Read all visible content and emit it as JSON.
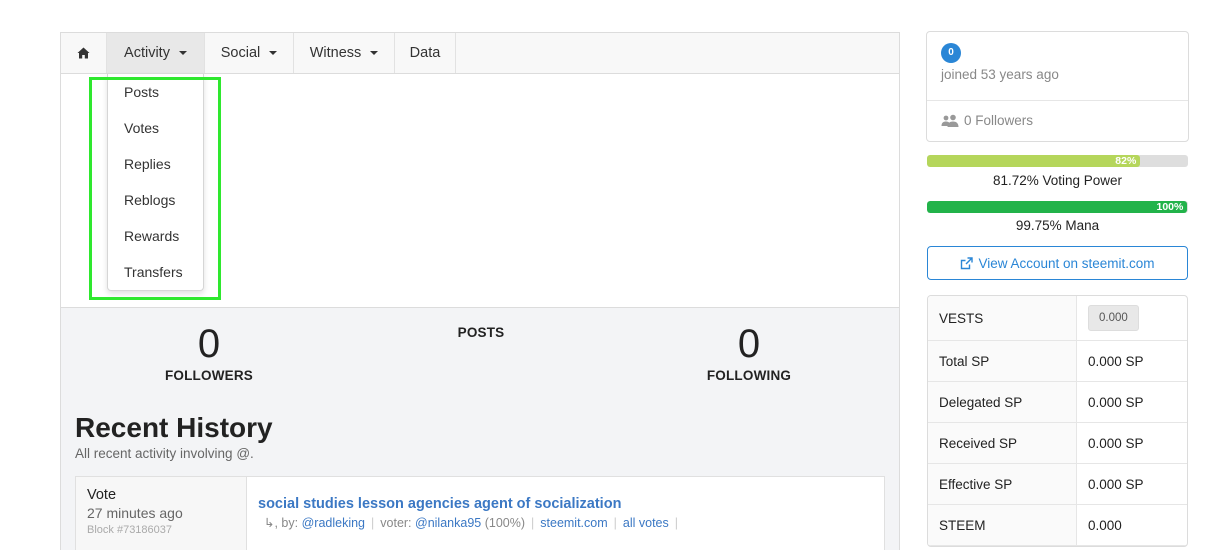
{
  "nav": {
    "items": [
      {
        "label": "Activity"
      },
      {
        "label": "Social"
      },
      {
        "label": "Witness"
      },
      {
        "label": "Data"
      }
    ]
  },
  "dropdown": {
    "items": [
      {
        "label": "Posts"
      },
      {
        "label": "Votes"
      },
      {
        "label": "Replies"
      },
      {
        "label": "Reblogs"
      },
      {
        "label": "Rewards"
      },
      {
        "label": "Transfers"
      }
    ]
  },
  "stats": {
    "followers": {
      "value": "0",
      "label": "FOLLOWERS"
    },
    "posts": {
      "label": "POSTS"
    },
    "following": {
      "value": "0",
      "label": "FOLLOWING"
    }
  },
  "history": {
    "title": "Recent History",
    "subtitle": "All recent activity involving @.",
    "entry": {
      "type": "Vote",
      "time": "27 minutes ago",
      "block": "Block #73186037",
      "link": "social studies lesson agencies agent of socialization",
      "by_prefix": "↳, by:",
      "author": "@radleking",
      "voter_prefix": "voter:",
      "voter": "@nilanka95",
      "percent": "(100%)",
      "steemit": "steemit.com",
      "all_votes": "all votes"
    }
  },
  "profile": {
    "reputation": "0",
    "joined": "joined 53 years ago",
    "followers": "0 Followers"
  },
  "voting_power": {
    "fill_percent": 81.72,
    "bar_label": "82%",
    "caption": "81.72% Voting Power",
    "color": "#b5d65b"
  },
  "mana": {
    "fill_percent": 99.75,
    "bar_label": "100%",
    "caption": "99.75% Mana",
    "color": "#22b34a"
  },
  "view_account": {
    "label": "View Account on steemit.com"
  },
  "sp_table": {
    "rows": [
      {
        "label": "VESTS",
        "value": "0.000"
      },
      {
        "label": "Total SP",
        "value": "0.000 SP"
      },
      {
        "label": "Delegated SP",
        "value": "0.000 SP"
      },
      {
        "label": "Received SP",
        "value": "0.000 SP"
      },
      {
        "label": "Effective SP",
        "value": "0.000 SP"
      },
      {
        "label": "STEEM",
        "value": "0.000"
      }
    ]
  },
  "colors": {
    "accent": "#2a86d6",
    "link": "#3b78c4",
    "highlight": "#2ee82e"
  }
}
